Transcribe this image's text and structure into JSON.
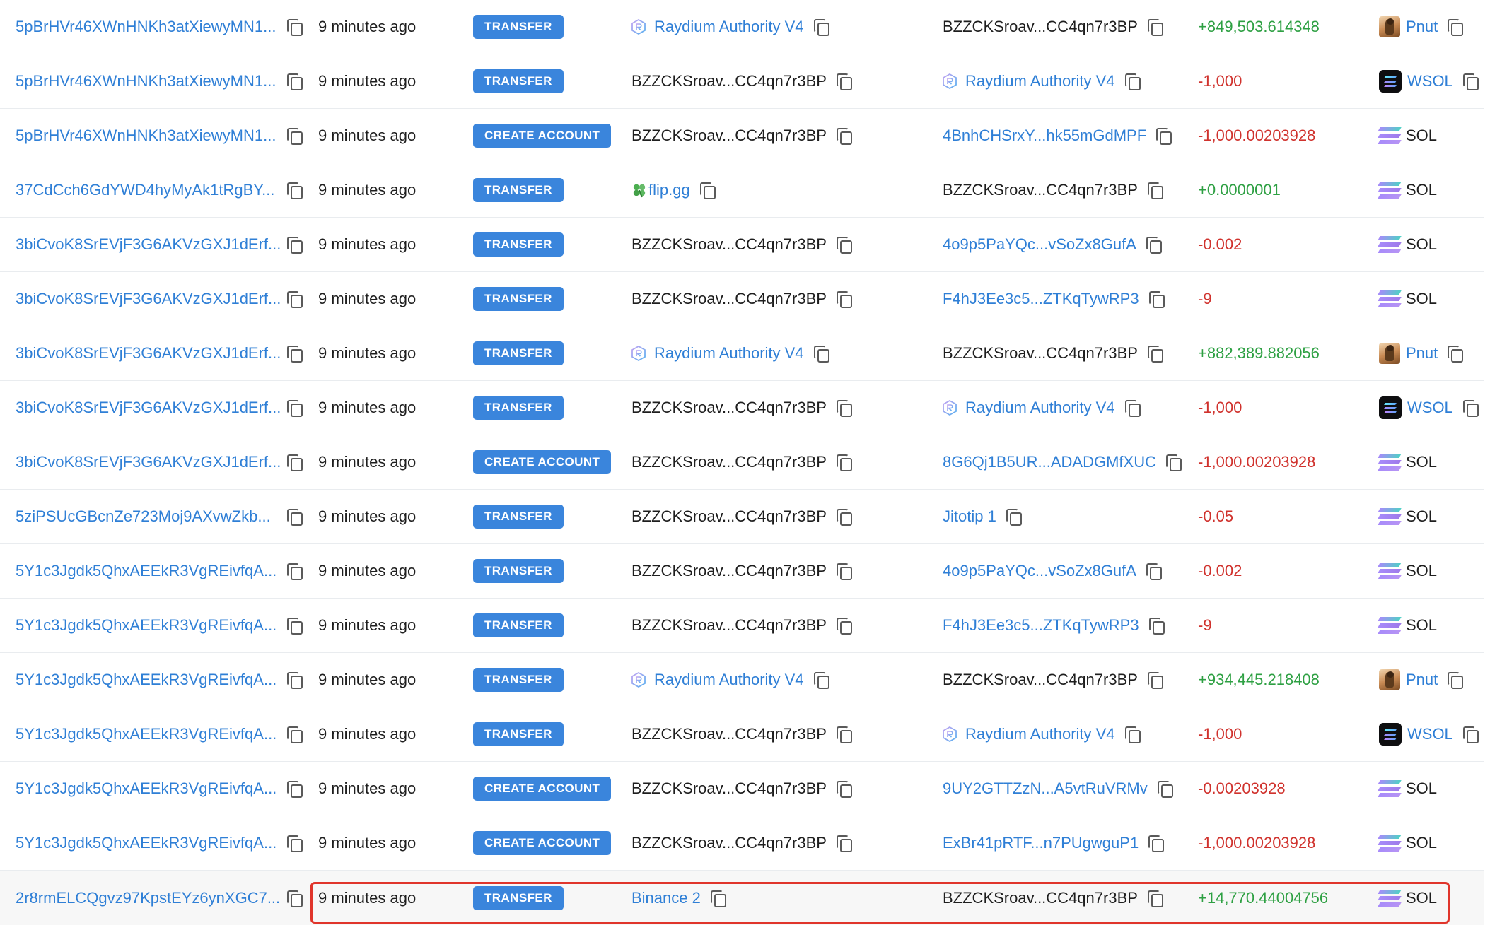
{
  "rows": [
    {
      "signature": "5pBrHVr46XWnHNKh3atXiewyMN1...",
      "time": "9 minutes ago",
      "action": "TRANSFER",
      "from": {
        "text": "Raydium Authority V4",
        "kind": "raydium"
      },
      "to": {
        "text": "BZZCKSroav...CC4qn7r3BP",
        "kind": "plain"
      },
      "amount": "+849,503.614348",
      "amount_sign": "pos",
      "token": {
        "name": "Pnut",
        "icon": "pnut-icon",
        "link": true,
        "copy": true
      }
    },
    {
      "signature": "5pBrHVr46XWnHNKh3atXiewyMN1...",
      "time": "9 minutes ago",
      "action": "TRANSFER",
      "from": {
        "text": "BZZCKSroav...CC4qn7r3BP",
        "kind": "plain"
      },
      "to": {
        "text": "Raydium Authority V4",
        "kind": "raydium"
      },
      "amount": "-1,000",
      "amount_sign": "neg",
      "token": {
        "name": "WSOL",
        "icon": "wsol-icon",
        "link": true,
        "copy": true
      }
    },
    {
      "signature": "5pBrHVr46XWnHNKh3atXiewyMN1...",
      "time": "9 minutes ago",
      "action": "CREATE ACCOUNT",
      "from": {
        "text": "BZZCKSroav...CC4qn7r3BP",
        "kind": "plain"
      },
      "to": {
        "text": "4BnhCHSrxY...hk55mGdMPF",
        "kind": "link"
      },
      "amount": "-1,000.00203928",
      "amount_sign": "neg",
      "token": {
        "name": "SOL",
        "icon": "sol-icon",
        "link": false,
        "copy": false
      }
    },
    {
      "signature": "37CdCch6GdYWD4hyMyAk1tRgBY...",
      "time": "9 minutes ago",
      "action": "TRANSFER",
      "from": {
        "text": "flip.gg",
        "kind": "flip"
      },
      "to": {
        "text": "BZZCKSroav...CC4qn7r3BP",
        "kind": "plain"
      },
      "amount": "+0.0000001",
      "amount_sign": "pos",
      "token": {
        "name": "SOL",
        "icon": "sol-icon",
        "link": false,
        "copy": false
      }
    },
    {
      "signature": "3biCvoK8SrEVjF3G6AKVzGXJ1dErf...",
      "time": "9 minutes ago",
      "action": "TRANSFER",
      "from": {
        "text": "BZZCKSroav...CC4qn7r3BP",
        "kind": "plain"
      },
      "to": {
        "text": "4o9p5PaYQc...vSoZx8GufA",
        "kind": "link"
      },
      "amount": "-0.002",
      "amount_sign": "neg",
      "token": {
        "name": "SOL",
        "icon": "sol-icon",
        "link": false,
        "copy": false
      }
    },
    {
      "signature": "3biCvoK8SrEVjF3G6AKVzGXJ1dErf...",
      "time": "9 minutes ago",
      "action": "TRANSFER",
      "from": {
        "text": "BZZCKSroav...CC4qn7r3BP",
        "kind": "plain"
      },
      "to": {
        "text": "F4hJ3Ee3c5...ZTKqTywRP3",
        "kind": "link"
      },
      "amount": "-9",
      "amount_sign": "neg",
      "token": {
        "name": "SOL",
        "icon": "sol-icon",
        "link": false,
        "copy": false
      }
    },
    {
      "signature": "3biCvoK8SrEVjF3G6AKVzGXJ1dErf...",
      "time": "9 minutes ago",
      "action": "TRANSFER",
      "from": {
        "text": "Raydium Authority V4",
        "kind": "raydium"
      },
      "to": {
        "text": "BZZCKSroav...CC4qn7r3BP",
        "kind": "plain"
      },
      "amount": "+882,389.882056",
      "amount_sign": "pos",
      "token": {
        "name": "Pnut",
        "icon": "pnut-icon",
        "link": true,
        "copy": true
      }
    },
    {
      "signature": "3biCvoK8SrEVjF3G6AKVzGXJ1dErf...",
      "time": "9 minutes ago",
      "action": "TRANSFER",
      "from": {
        "text": "BZZCKSroav...CC4qn7r3BP",
        "kind": "plain"
      },
      "to": {
        "text": "Raydium Authority V4",
        "kind": "raydium"
      },
      "amount": "-1,000",
      "amount_sign": "neg",
      "token": {
        "name": "WSOL",
        "icon": "wsol-icon",
        "link": true,
        "copy": true
      }
    },
    {
      "signature": "3biCvoK8SrEVjF3G6AKVzGXJ1dErf...",
      "time": "9 minutes ago",
      "action": "CREATE ACCOUNT",
      "from": {
        "text": "BZZCKSroav...CC4qn7r3BP",
        "kind": "plain"
      },
      "to": {
        "text": "8G6Qj1B5UR...ADADGMfXUC",
        "kind": "link"
      },
      "amount": "-1,000.00203928",
      "amount_sign": "neg",
      "token": {
        "name": "SOL",
        "icon": "sol-icon",
        "link": false,
        "copy": false
      }
    },
    {
      "signature": "5ziPSUcGBcnZe723Moj9AXvwZkb...",
      "time": "9 minutes ago",
      "action": "TRANSFER",
      "from": {
        "text": "BZZCKSroav...CC4qn7r3BP",
        "kind": "plain"
      },
      "to": {
        "text": "Jitotip 1",
        "kind": "link"
      },
      "amount": "-0.05",
      "amount_sign": "neg",
      "token": {
        "name": "SOL",
        "icon": "sol-icon",
        "link": false,
        "copy": false
      }
    },
    {
      "signature": "5Y1c3Jgdk5QhxAEEkR3VgREivfqA...",
      "time": "9 minutes ago",
      "action": "TRANSFER",
      "from": {
        "text": "BZZCKSroav...CC4qn7r3BP",
        "kind": "plain"
      },
      "to": {
        "text": "4o9p5PaYQc...vSoZx8GufA",
        "kind": "link"
      },
      "amount": "-0.002",
      "amount_sign": "neg",
      "token": {
        "name": "SOL",
        "icon": "sol-icon",
        "link": false,
        "copy": false
      }
    },
    {
      "signature": "5Y1c3Jgdk5QhxAEEkR3VgREivfqA...",
      "time": "9 minutes ago",
      "action": "TRANSFER",
      "from": {
        "text": "BZZCKSroav...CC4qn7r3BP",
        "kind": "plain"
      },
      "to": {
        "text": "F4hJ3Ee3c5...ZTKqTywRP3",
        "kind": "link"
      },
      "amount": "-9",
      "amount_sign": "neg",
      "token": {
        "name": "SOL",
        "icon": "sol-icon",
        "link": false,
        "copy": false
      }
    },
    {
      "signature": "5Y1c3Jgdk5QhxAEEkR3VgREivfqA...",
      "time": "9 minutes ago",
      "action": "TRANSFER",
      "from": {
        "text": "Raydium Authority V4",
        "kind": "raydium"
      },
      "to": {
        "text": "BZZCKSroav...CC4qn7r3BP",
        "kind": "plain"
      },
      "amount": "+934,445.218408",
      "amount_sign": "pos",
      "token": {
        "name": "Pnut",
        "icon": "pnut-icon",
        "link": true,
        "copy": true
      }
    },
    {
      "signature": "5Y1c3Jgdk5QhxAEEkR3VgREivfqA...",
      "time": "9 minutes ago",
      "action": "TRANSFER",
      "from": {
        "text": "BZZCKSroav...CC4qn7r3BP",
        "kind": "plain"
      },
      "to": {
        "text": "Raydium Authority V4",
        "kind": "raydium"
      },
      "amount": "-1,000",
      "amount_sign": "neg",
      "token": {
        "name": "WSOL",
        "icon": "wsol-icon",
        "link": true,
        "copy": true
      }
    },
    {
      "signature": "5Y1c3Jgdk5QhxAEEkR3VgREivfqA...",
      "time": "9 minutes ago",
      "action": "CREATE ACCOUNT",
      "from": {
        "text": "BZZCKSroav...CC4qn7r3BP",
        "kind": "plain"
      },
      "to": {
        "text": "9UY2GTTZzN...A5vtRuVRMv",
        "kind": "link"
      },
      "amount": "-0.00203928",
      "amount_sign": "neg",
      "token": {
        "name": "SOL",
        "icon": "sol-icon",
        "link": false,
        "copy": false
      }
    },
    {
      "signature": "5Y1c3Jgdk5QhxAEEkR3VgREivfqA...",
      "time": "9 minutes ago",
      "action": "CREATE ACCOUNT",
      "from": {
        "text": "BZZCKSroav...CC4qn7r3BP",
        "kind": "plain"
      },
      "to": {
        "text": "ExBr41pRTF...n7PUgwguP1",
        "kind": "link"
      },
      "amount": "-1,000.00203928",
      "amount_sign": "neg",
      "token": {
        "name": "SOL",
        "icon": "sol-icon",
        "link": false,
        "copy": false
      }
    },
    {
      "signature": "2r8rmELCQgvz97KpstEYz6ynXGC7...",
      "time": "9 minutes ago",
      "action": "TRANSFER",
      "from": {
        "text": "Binance 2",
        "kind": "link"
      },
      "to": {
        "text": "BZZCKSroav...CC4qn7r3BP",
        "kind": "plain"
      },
      "amount": "+14,770.44004756",
      "amount_sign": "pos",
      "token": {
        "name": "SOL",
        "icon": "sol-icon",
        "link": false,
        "copy": false
      },
      "highlighted": true
    }
  ],
  "colors": {
    "link": "#2f7fd6",
    "positive": "#2ea043",
    "negative": "#d0322d",
    "badge": "#3a85dc",
    "highlight_border": "#e0352b"
  }
}
